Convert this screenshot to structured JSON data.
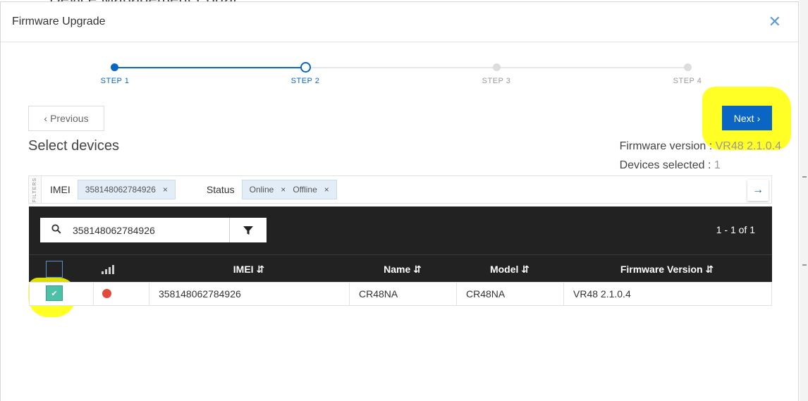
{
  "background": {
    "title": "Device Management Portal"
  },
  "modal": {
    "title": "Firmware Upgrade"
  },
  "stepper": {
    "steps": [
      {
        "label": "STEP 1",
        "state": "done"
      },
      {
        "label": "STEP 2",
        "state": "active"
      },
      {
        "label": "STEP 3",
        "state": "pending"
      },
      {
        "label": "STEP 4",
        "state": "pending"
      }
    ]
  },
  "nav": {
    "previous_label": "Previous",
    "next_label": "Next"
  },
  "page": {
    "title": "Select devices"
  },
  "firmware": {
    "version_label": "Firmware version :",
    "version_value": "VR48 2.1.0.4",
    "selected_label": "Devices selected :",
    "selected_value": "1"
  },
  "filters": {
    "tag": "FILTERS",
    "imei_label": "IMEI",
    "imei_value": "358148062784926",
    "status_label": "Status",
    "status_values": [
      "Online",
      "Offline"
    ]
  },
  "table": {
    "search_value": "358148062784926",
    "pagination": "1 - 1 of 1",
    "columns": [
      "IMEI",
      "Name",
      "Model",
      "Firmware Version"
    ],
    "rows": [
      {
        "selected": true,
        "status": "offline",
        "imei": "358148062784926",
        "name": "CR48NA",
        "model": "CR48NA",
        "firmware": "VR48 2.1.0.4"
      }
    ]
  },
  "colors": {
    "primary": "#0a66c2",
    "header_bg": "#222222",
    "check_selected": "#4dc0a8",
    "status_offline": "#e04b3c",
    "highlight": "#ffff00"
  }
}
